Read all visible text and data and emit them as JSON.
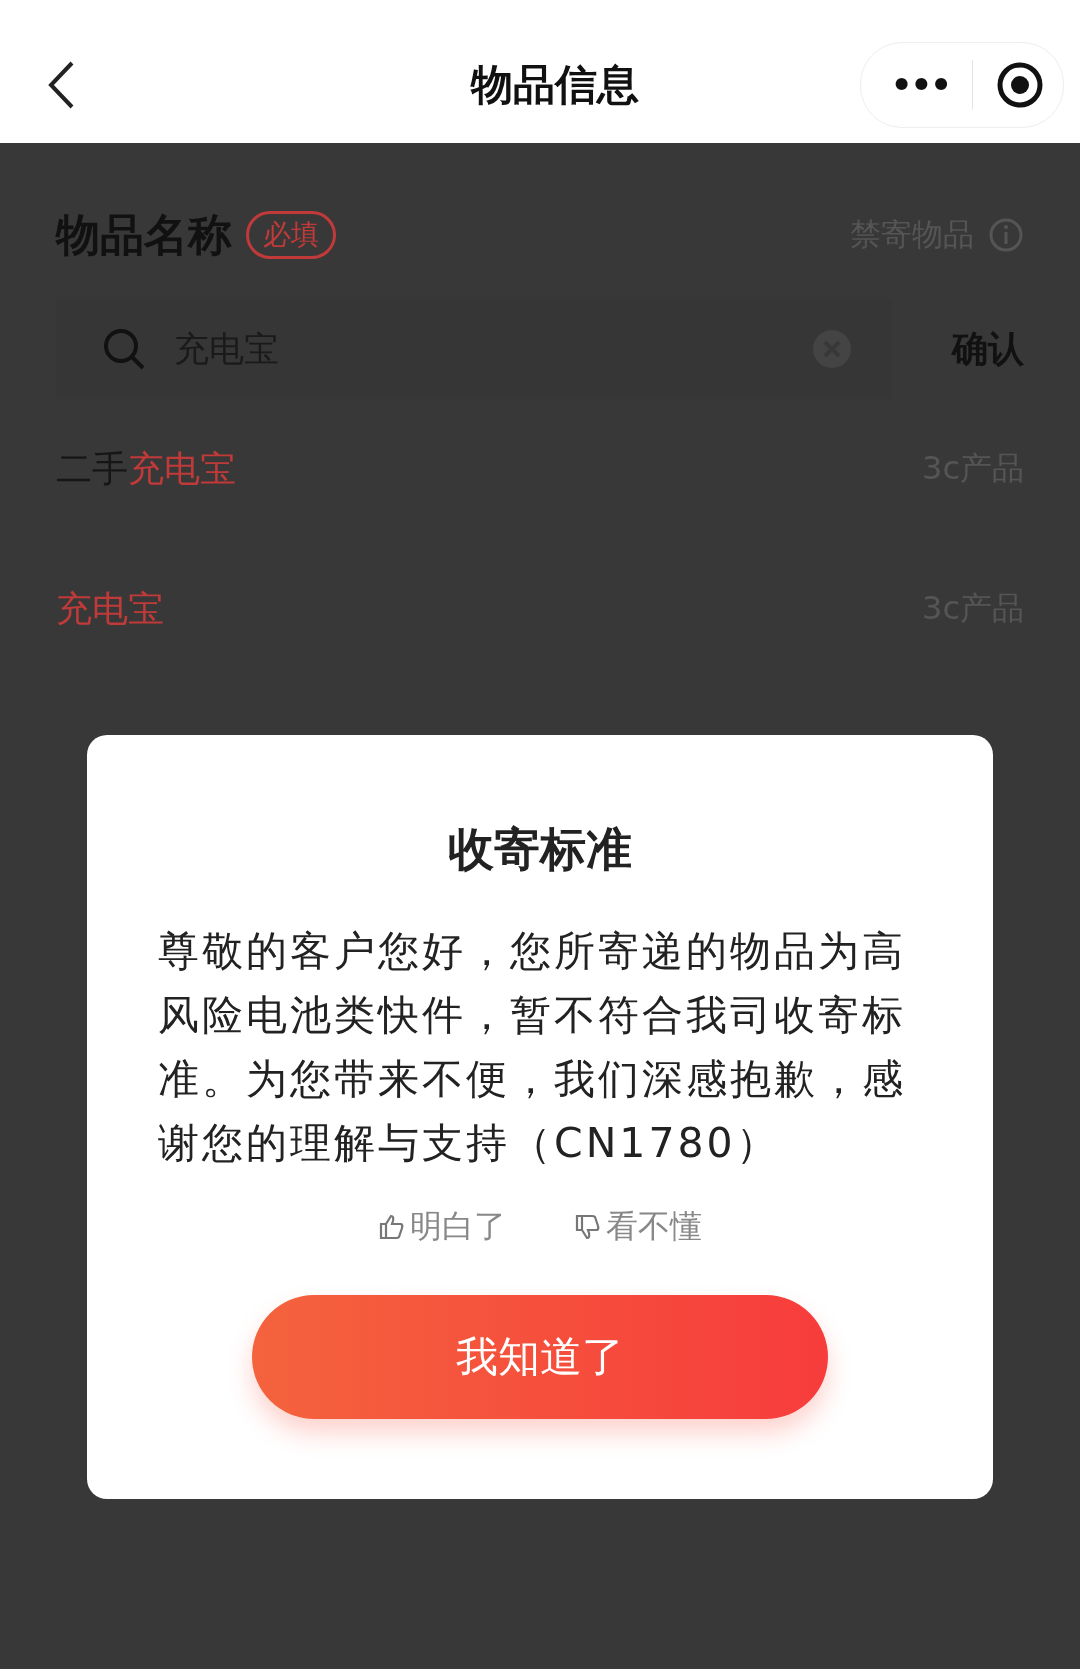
{
  "header": {
    "title": "物品信息",
    "menu_glyph": "•••"
  },
  "form": {
    "label": "物品名称",
    "required_badge": "必填",
    "prohibited_link": "禁寄物品",
    "search": {
      "value": "充电宝"
    },
    "confirm": "确认"
  },
  "suggestions": [
    {
      "segments": [
        {
          "text": "二手",
          "match": false
        },
        {
          "text": "充电宝",
          "match": true
        }
      ],
      "category": "3c产品"
    },
    {
      "segments": [
        {
          "text": "充电宝",
          "match": true
        }
      ],
      "category": "3c产品"
    }
  ],
  "dialog": {
    "title": "收寄标准",
    "message": "尊敬的客户您好，您所寄递的物品为高风险电池类快件，暂不符合我司收寄标准。为您带来不便，我们深感抱歉，感谢您的理解与支持（CN1780）",
    "feedback": [
      {
        "kind": "like",
        "label": "明白了"
      },
      {
        "kind": "dislike",
        "label": "看不懂"
      }
    ],
    "button": "我知道了"
  }
}
